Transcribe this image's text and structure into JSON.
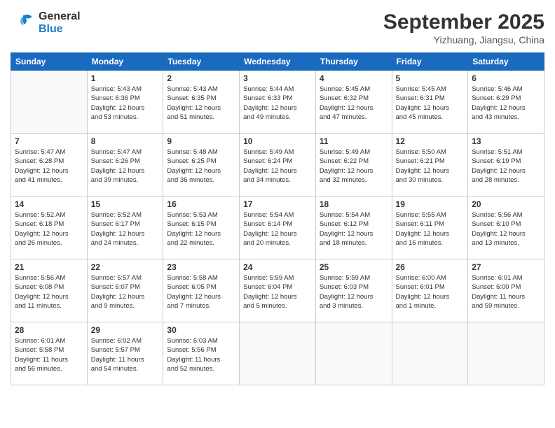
{
  "header": {
    "logo_general": "General",
    "logo_blue": "Blue",
    "month_title": "September 2025",
    "location": "Yizhuang, Jiangsu, China"
  },
  "weekdays": [
    "Sunday",
    "Monday",
    "Tuesday",
    "Wednesday",
    "Thursday",
    "Friday",
    "Saturday"
  ],
  "weeks": [
    [
      {
        "day": "",
        "info": ""
      },
      {
        "day": "1",
        "info": "Sunrise: 5:43 AM\nSunset: 6:36 PM\nDaylight: 12 hours\nand 53 minutes."
      },
      {
        "day": "2",
        "info": "Sunrise: 5:43 AM\nSunset: 6:35 PM\nDaylight: 12 hours\nand 51 minutes."
      },
      {
        "day": "3",
        "info": "Sunrise: 5:44 AM\nSunset: 6:33 PM\nDaylight: 12 hours\nand 49 minutes."
      },
      {
        "day": "4",
        "info": "Sunrise: 5:45 AM\nSunset: 6:32 PM\nDaylight: 12 hours\nand 47 minutes."
      },
      {
        "day": "5",
        "info": "Sunrise: 5:45 AM\nSunset: 6:31 PM\nDaylight: 12 hours\nand 45 minutes."
      },
      {
        "day": "6",
        "info": "Sunrise: 5:46 AM\nSunset: 6:29 PM\nDaylight: 12 hours\nand 43 minutes."
      }
    ],
    [
      {
        "day": "7",
        "info": "Sunrise: 5:47 AM\nSunset: 6:28 PM\nDaylight: 12 hours\nand 41 minutes."
      },
      {
        "day": "8",
        "info": "Sunrise: 5:47 AM\nSunset: 6:26 PM\nDaylight: 12 hours\nand 39 minutes."
      },
      {
        "day": "9",
        "info": "Sunrise: 5:48 AM\nSunset: 6:25 PM\nDaylight: 12 hours\nand 36 minutes."
      },
      {
        "day": "10",
        "info": "Sunrise: 5:49 AM\nSunset: 6:24 PM\nDaylight: 12 hours\nand 34 minutes."
      },
      {
        "day": "11",
        "info": "Sunrise: 5:49 AM\nSunset: 6:22 PM\nDaylight: 12 hours\nand 32 minutes."
      },
      {
        "day": "12",
        "info": "Sunrise: 5:50 AM\nSunset: 6:21 PM\nDaylight: 12 hours\nand 30 minutes."
      },
      {
        "day": "13",
        "info": "Sunrise: 5:51 AM\nSunset: 6:19 PM\nDaylight: 12 hours\nand 28 minutes."
      }
    ],
    [
      {
        "day": "14",
        "info": "Sunrise: 5:52 AM\nSunset: 6:18 PM\nDaylight: 12 hours\nand 26 minutes."
      },
      {
        "day": "15",
        "info": "Sunrise: 5:52 AM\nSunset: 6:17 PM\nDaylight: 12 hours\nand 24 minutes."
      },
      {
        "day": "16",
        "info": "Sunrise: 5:53 AM\nSunset: 6:15 PM\nDaylight: 12 hours\nand 22 minutes."
      },
      {
        "day": "17",
        "info": "Sunrise: 5:54 AM\nSunset: 6:14 PM\nDaylight: 12 hours\nand 20 minutes."
      },
      {
        "day": "18",
        "info": "Sunrise: 5:54 AM\nSunset: 6:12 PM\nDaylight: 12 hours\nand 18 minutes."
      },
      {
        "day": "19",
        "info": "Sunrise: 5:55 AM\nSunset: 6:11 PM\nDaylight: 12 hours\nand 16 minutes."
      },
      {
        "day": "20",
        "info": "Sunrise: 5:56 AM\nSunset: 6:10 PM\nDaylight: 12 hours\nand 13 minutes."
      }
    ],
    [
      {
        "day": "21",
        "info": "Sunrise: 5:56 AM\nSunset: 6:08 PM\nDaylight: 12 hours\nand 11 minutes."
      },
      {
        "day": "22",
        "info": "Sunrise: 5:57 AM\nSunset: 6:07 PM\nDaylight: 12 hours\nand 9 minutes."
      },
      {
        "day": "23",
        "info": "Sunrise: 5:58 AM\nSunset: 6:05 PM\nDaylight: 12 hours\nand 7 minutes."
      },
      {
        "day": "24",
        "info": "Sunrise: 5:59 AM\nSunset: 6:04 PM\nDaylight: 12 hours\nand 5 minutes."
      },
      {
        "day": "25",
        "info": "Sunrise: 5:59 AM\nSunset: 6:03 PM\nDaylight: 12 hours\nand 3 minutes."
      },
      {
        "day": "26",
        "info": "Sunrise: 6:00 AM\nSunset: 6:01 PM\nDaylight: 12 hours\nand 1 minute."
      },
      {
        "day": "27",
        "info": "Sunrise: 6:01 AM\nSunset: 6:00 PM\nDaylight: 11 hours\nand 59 minutes."
      }
    ],
    [
      {
        "day": "28",
        "info": "Sunrise: 6:01 AM\nSunset: 5:58 PM\nDaylight: 11 hours\nand 56 minutes."
      },
      {
        "day": "29",
        "info": "Sunrise: 6:02 AM\nSunset: 5:57 PM\nDaylight: 11 hours\nand 54 minutes."
      },
      {
        "day": "30",
        "info": "Sunrise: 6:03 AM\nSunset: 5:56 PM\nDaylight: 11 hours\nand 52 minutes."
      },
      {
        "day": "",
        "info": ""
      },
      {
        "day": "",
        "info": ""
      },
      {
        "day": "",
        "info": ""
      },
      {
        "day": "",
        "info": ""
      }
    ]
  ]
}
